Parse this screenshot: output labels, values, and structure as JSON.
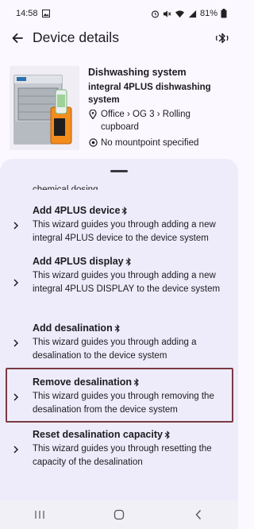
{
  "status_bar": {
    "time": "14:58",
    "battery": "81%"
  },
  "app_bar": {
    "title": "Device details"
  },
  "device": {
    "name": "Dishwashing system",
    "model": "integral 4PLUS dishwashing system",
    "location": "Office › OG 3 › Rolling cupboard",
    "mountpoint": "No mountpoint specified"
  },
  "sheet": {
    "clipped_text": "chemical dosing",
    "items": [
      {
        "title": "Add 4PLUS device",
        "description": "This wizard guides you through adding a new integral 4PLUS device to the device system"
      },
      {
        "title": "Add 4PLUS display",
        "description": "This wizard guides you through adding a new integral 4PLUS DISPLAY to the device system"
      },
      {
        "title": "Add desalination",
        "description": "This wizard guides you through adding a desalination to the device system"
      },
      {
        "title": "Remove desalination",
        "description": "This wizard guides you through removing the desalination from the device system"
      },
      {
        "title": "Reset desalination capacity",
        "description": "This wizard guides you through resetting the capacity of the desalination"
      }
    ]
  },
  "colors": {
    "sheet_bg": "#eeecfa",
    "page_bg": "#fbf8ff",
    "highlight": "#7a3a44"
  }
}
